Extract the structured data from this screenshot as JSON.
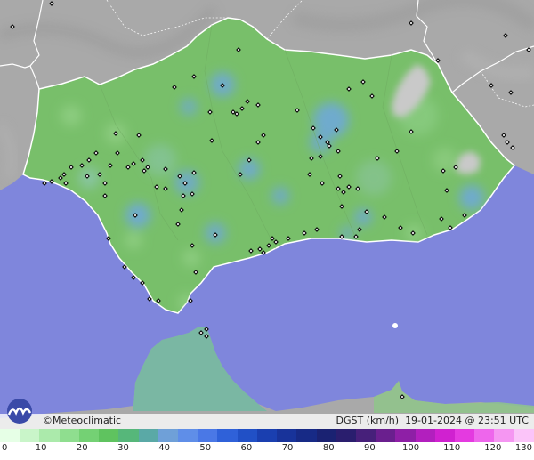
{
  "brand": "©Meteoclimatic",
  "variable": "DGST (km/h)",
  "datetime": "19-01-2024 @ 23:51 UTC",
  "colors": {
    "sea": "#7f86dc",
    "land_outside": "#a9a9a9",
    "region_base": "#78bf6a",
    "mountain": "#c7c7c7"
  },
  "legend": {
    "ticks": [
      "0",
      "10",
      "20",
      "30",
      "40",
      "50",
      "60",
      "70",
      "80",
      "90",
      "100",
      "110",
      "120",
      "130"
    ],
    "colors": [
      "#e6ffe6",
      "#c9f5c9",
      "#abeaab",
      "#8fde8f",
      "#74d174",
      "#5fc35f",
      "#56b77a",
      "#5aa9a6",
      "#6fa0d8",
      "#5f8ee8",
      "#4a78e6",
      "#2f61d9",
      "#2150c6",
      "#1a3fb0",
      "#18339a",
      "#172a86",
      "#1a2272",
      "#2a1e6e",
      "#47207a",
      "#6a1f8e",
      "#8e1fa6",
      "#b21fbe",
      "#d021d0",
      "#e43ae0",
      "#ee66ec",
      "#f596f2",
      "#fbc4f9"
    ]
  }
}
